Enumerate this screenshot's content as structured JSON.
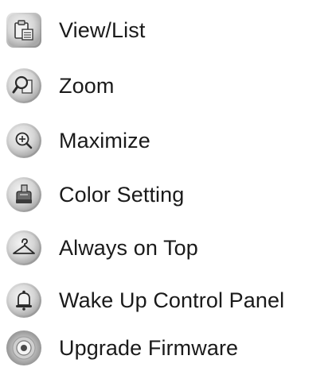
{
  "menu": {
    "items": [
      {
        "label": "View/List",
        "icon": "clipboard-list-icon"
      },
      {
        "label": "Zoom",
        "icon": "magnifier-icon"
      },
      {
        "label": "Maximize",
        "icon": "zoom-in-icon"
      },
      {
        "label": "Color Setting",
        "icon": "paint-bucket-icon"
      },
      {
        "label": "Always on Top",
        "icon": "hanger-icon"
      },
      {
        "label": "Wake Up Control Panel",
        "icon": "bell-icon"
      },
      {
        "label": "Upgrade Firmware",
        "icon": "target-dot-icon"
      }
    ]
  },
  "colors": {
    "icon_rim": "#9a9a9a",
    "icon_face": "#d9d9d9",
    "text": "#1a1a1a"
  }
}
